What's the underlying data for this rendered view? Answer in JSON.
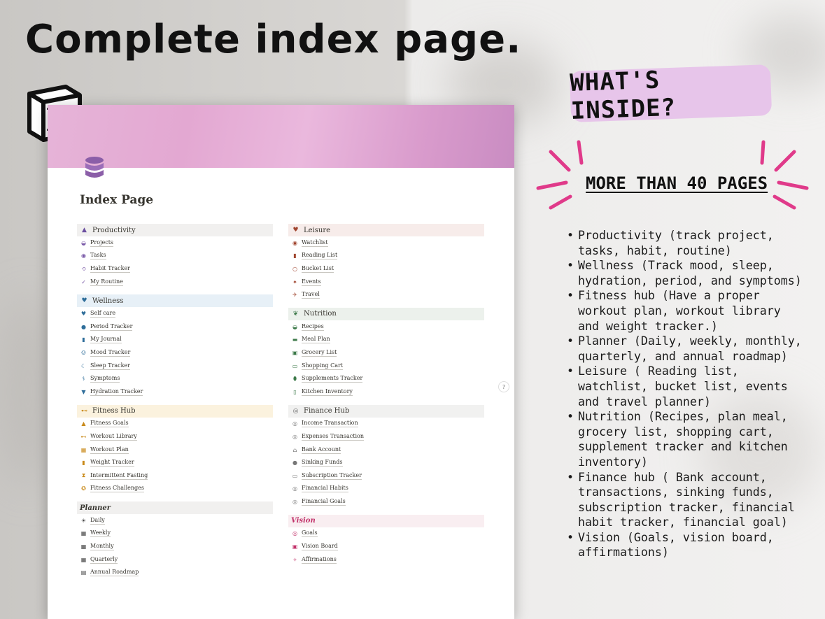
{
  "headline": "Complete index page.",
  "badge": "WHAT'S INSIDE?",
  "pages_label": "MORE THAN 40 PAGES",
  "features": [
    "Productivity (track project, tasks, habit, routine)",
    "Wellness (Track mood, sleep, hydration, period, and symptoms)",
    "Fitness hub (Have a proper workout plan, workout library and weight tracker.)",
    "Planner (Daily, weekly, monthly, quarterly, and annual roadmap)",
    "Leisure ( Reading list, watchlist, bucket list, events and travel planner)",
    "Nutrition (Recipes, plan meal, grocery list, shopping cart, supplement tracker and kitchen inventory)",
    "Finance hub ( Bank account, transactions, sinking funds, subscription tracker, financial habit tracker, financial goal)",
    "Vision (Goals, vision board, affirmations)"
  ],
  "page": {
    "title": "Index Page",
    "help_label": "?",
    "left_sections": [
      {
        "title": "Productivity",
        "icon": "chart-icon",
        "bg": "#f1f0ef",
        "color": "#6b4fa0",
        "glyph": "▲",
        "italic": false,
        "items": [
          {
            "label": "Projects",
            "icon": "box-icon",
            "glyph": "◒",
            "color": "#7a5aa8"
          },
          {
            "label": "Tasks",
            "icon": "task-icon",
            "glyph": "◉",
            "color": "#7a5aa8"
          },
          {
            "label": "Habit Tracker",
            "icon": "loop-icon",
            "glyph": "⟲",
            "color": "#7a5aa8"
          },
          {
            "label": "My Routine",
            "icon": "check-icon",
            "glyph": "✓",
            "color": "#7a5aa8"
          }
        ]
      },
      {
        "title": "Wellness",
        "icon": "heart-icon",
        "bg": "#e7f0f7",
        "color": "#2f6e9a",
        "glyph": "♥",
        "italic": false,
        "items": [
          {
            "label": "Self care",
            "icon": "heart-icon",
            "glyph": "♥",
            "color": "#2f6e9a"
          },
          {
            "label": "Period Tracker",
            "icon": "drop-icon",
            "glyph": "●",
            "color": "#2f6e9a"
          },
          {
            "label": "My Journal",
            "icon": "book-icon",
            "glyph": "▮",
            "color": "#2f6e9a"
          },
          {
            "label": "Mood Tracker",
            "icon": "smile-icon",
            "glyph": "☺",
            "color": "#2f6e9a"
          },
          {
            "label": "Sleep Tracker",
            "icon": "moon-icon",
            "glyph": "☾",
            "color": "#2f6e9a"
          },
          {
            "label": "Symptoms",
            "icon": "thermometer-icon",
            "glyph": "⚕",
            "color": "#2f6e9a"
          },
          {
            "label": "Hydration Tracker",
            "icon": "cup-icon",
            "glyph": "▼",
            "color": "#2f6e9a"
          }
        ]
      },
      {
        "title": "Fitness Hub",
        "icon": "dumbbell-icon",
        "bg": "#fbf2de",
        "color": "#c98a1a",
        "glyph": "⊷",
        "italic": false,
        "items": [
          {
            "label": "Fitness Goals",
            "icon": "trophy-icon",
            "glyph": "▲",
            "color": "#c98a1a"
          },
          {
            "label": "Workout Library",
            "icon": "dumbbell-icon",
            "glyph": "⊷",
            "color": "#c98a1a"
          },
          {
            "label": "Workout Plan",
            "icon": "calendar-icon",
            "glyph": "▦",
            "color": "#c98a1a"
          },
          {
            "label": "Weight Tracker",
            "icon": "scale-icon",
            "glyph": "▮",
            "color": "#c98a1a"
          },
          {
            "label": "Intermittent Fasting",
            "icon": "hourglass-icon",
            "glyph": "⧗",
            "color": "#c98a1a"
          },
          {
            "label": "Fitness Challenges",
            "icon": "medal-icon",
            "glyph": "✪",
            "color": "#c98a1a"
          }
        ]
      },
      {
        "title": "Planner",
        "icon": "",
        "bg": "#f1f0ef",
        "color": "#37352f",
        "glyph": "",
        "italic": true,
        "items": [
          {
            "label": "Daily",
            "icon": "sun-icon",
            "glyph": "☀",
            "color": "#444"
          },
          {
            "label": "Weekly",
            "icon": "calendar-icon",
            "glyph": "▦",
            "color": "#444"
          },
          {
            "label": "Monthly",
            "icon": "calendar-icon",
            "glyph": "▦",
            "color": "#444"
          },
          {
            "label": "Quarterly",
            "icon": "calendar-icon",
            "glyph": "▦",
            "color": "#444"
          },
          {
            "label": "Annual  Roadmap",
            "icon": "map-icon",
            "glyph": "▤",
            "color": "#444"
          }
        ]
      }
    ],
    "right_sections": [
      {
        "title": "Leisure",
        "icon": "heart-icon",
        "bg": "#f7ecea",
        "color": "#a0452f",
        "glyph": "♥",
        "italic": false,
        "items": [
          {
            "label": "Watchlist",
            "icon": "film-icon",
            "glyph": "◉",
            "color": "#a0452f"
          },
          {
            "label": "Reading List",
            "icon": "book-icon",
            "glyph": "▮",
            "color": "#a0452f"
          },
          {
            "label": "Bucket List",
            "icon": "search-icon",
            "glyph": "○",
            "color": "#a0452f"
          },
          {
            "label": "Events",
            "icon": "party-icon",
            "glyph": "✦",
            "color": "#a0452f"
          },
          {
            "label": "Travel",
            "icon": "plane-icon",
            "glyph": "✈",
            "color": "#a0452f"
          }
        ]
      },
      {
        "title": "Nutrition",
        "icon": "leaf-icon",
        "bg": "#ecf1ec",
        "color": "#3d7a4a",
        "glyph": "❦",
        "italic": false,
        "items": [
          {
            "label": "Recipes",
            "icon": "bowl-icon",
            "glyph": "◒",
            "color": "#3d7a4a"
          },
          {
            "label": "Meal Plan",
            "icon": "plate-icon",
            "glyph": "▬",
            "color": "#3d7a4a"
          },
          {
            "label": "Grocery List",
            "icon": "bag-icon",
            "glyph": "▣",
            "color": "#3d7a4a"
          },
          {
            "label": "Shopping Cart",
            "icon": "cart-icon",
            "glyph": "▭",
            "color": "#3d7a4a"
          },
          {
            "label": "Supplements Tracker",
            "icon": "pill-icon",
            "glyph": "⬮",
            "color": "#3d7a4a"
          },
          {
            "label": "Kitchen Inventory",
            "icon": "fridge-icon",
            "glyph": "▯",
            "color": "#3d7a4a"
          }
        ]
      },
      {
        "title": "Finance Hub",
        "icon": "coins-icon",
        "bg": "#f1f1f0",
        "color": "#666",
        "glyph": "◎",
        "italic": false,
        "items": [
          {
            "label": "Income Transaction",
            "icon": "coins-icon",
            "glyph": "◎",
            "color": "#777"
          },
          {
            "label": "Expenses Transaction",
            "icon": "coins-icon",
            "glyph": "◎",
            "color": "#777"
          },
          {
            "label": "Bank Account",
            "icon": "bank-icon",
            "glyph": "⌂",
            "color": "#777"
          },
          {
            "label": "Sinking Funds",
            "icon": "piggy-icon",
            "glyph": "●",
            "color": "#777"
          },
          {
            "label": "Subscription Tracker",
            "icon": "card-icon",
            "glyph": "▭",
            "color": "#777"
          },
          {
            "label": "Financial Habits",
            "icon": "coins-icon",
            "glyph": "◎",
            "color": "#777"
          },
          {
            "label": "Financial Goals",
            "icon": "target-icon",
            "glyph": "◎",
            "color": "#777"
          }
        ]
      },
      {
        "title": "Vision",
        "icon": "",
        "bg": "#f9eef1",
        "color": "#c2336b",
        "glyph": "",
        "italic": true,
        "items": [
          {
            "label": "Goals",
            "icon": "target-icon",
            "glyph": "◎",
            "color": "#c2336b"
          },
          {
            "label": "Vision Board",
            "icon": "image-icon",
            "glyph": "▣",
            "color": "#c2336b"
          },
          {
            "label": "Affirmations",
            "icon": "sparkle-icon",
            "glyph": "✧",
            "color": "#c2336b"
          }
        ]
      }
    ]
  }
}
